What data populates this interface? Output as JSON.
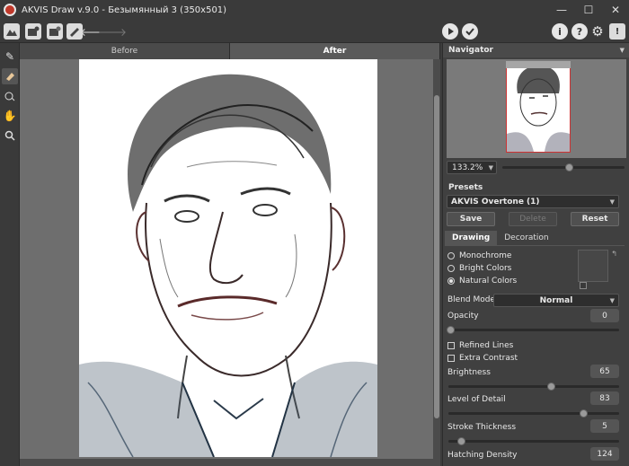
{
  "window": {
    "title": "AKVIS Draw v.9.0 - Безымянный 3 (350x501)",
    "minimize": "—",
    "maximize": "☐",
    "close": "✕"
  },
  "toolbar": {
    "icons": [
      "landscape-icon",
      "open-image-icon",
      "batch-icon",
      "settings-tools-icon",
      "undo-icon",
      "redo-icon",
      "run-icon",
      "apply-icon",
      "info-icon",
      "help-icon",
      "preferences-icon",
      "notify-icon"
    ]
  },
  "tools": [
    "pencil-tool",
    "eraser-tool",
    "history-brush-tool",
    "hand-tool",
    "zoom-tool"
  ],
  "canvas": {
    "tab_before": "Before",
    "tab_after": "After"
  },
  "navigator": {
    "title": "Navigator",
    "zoom": "133.2%",
    "zoom_slider_pos": 0.52
  },
  "presets": {
    "label": "Presets",
    "selected": "AKVIS Overtone (1)",
    "save": "Save",
    "delete": "Delete",
    "reset": "Reset"
  },
  "subtabs": {
    "drawing": "Drawing",
    "decoration": "Decoration"
  },
  "color_mode": {
    "monochrome": "Monochrome",
    "bright": "Bright Colors",
    "natural": "Natural Colors",
    "selected": "natural"
  },
  "params": {
    "blend_mode_label": "Blend Mode",
    "blend_mode_value": "Normal",
    "opacity_label": "Opacity",
    "opacity_value": "0",
    "refined_lines": "Refined Lines",
    "extra_contrast": "Extra Contrast",
    "brightness_label": "Brightness",
    "brightness_value": "65",
    "detail_label": "Level of Detail",
    "detail_value": "83",
    "stroke_label": "Stroke Thickness",
    "stroke_value": "5",
    "hatching_label": "Hatching Density",
    "hatching_value": "124"
  }
}
